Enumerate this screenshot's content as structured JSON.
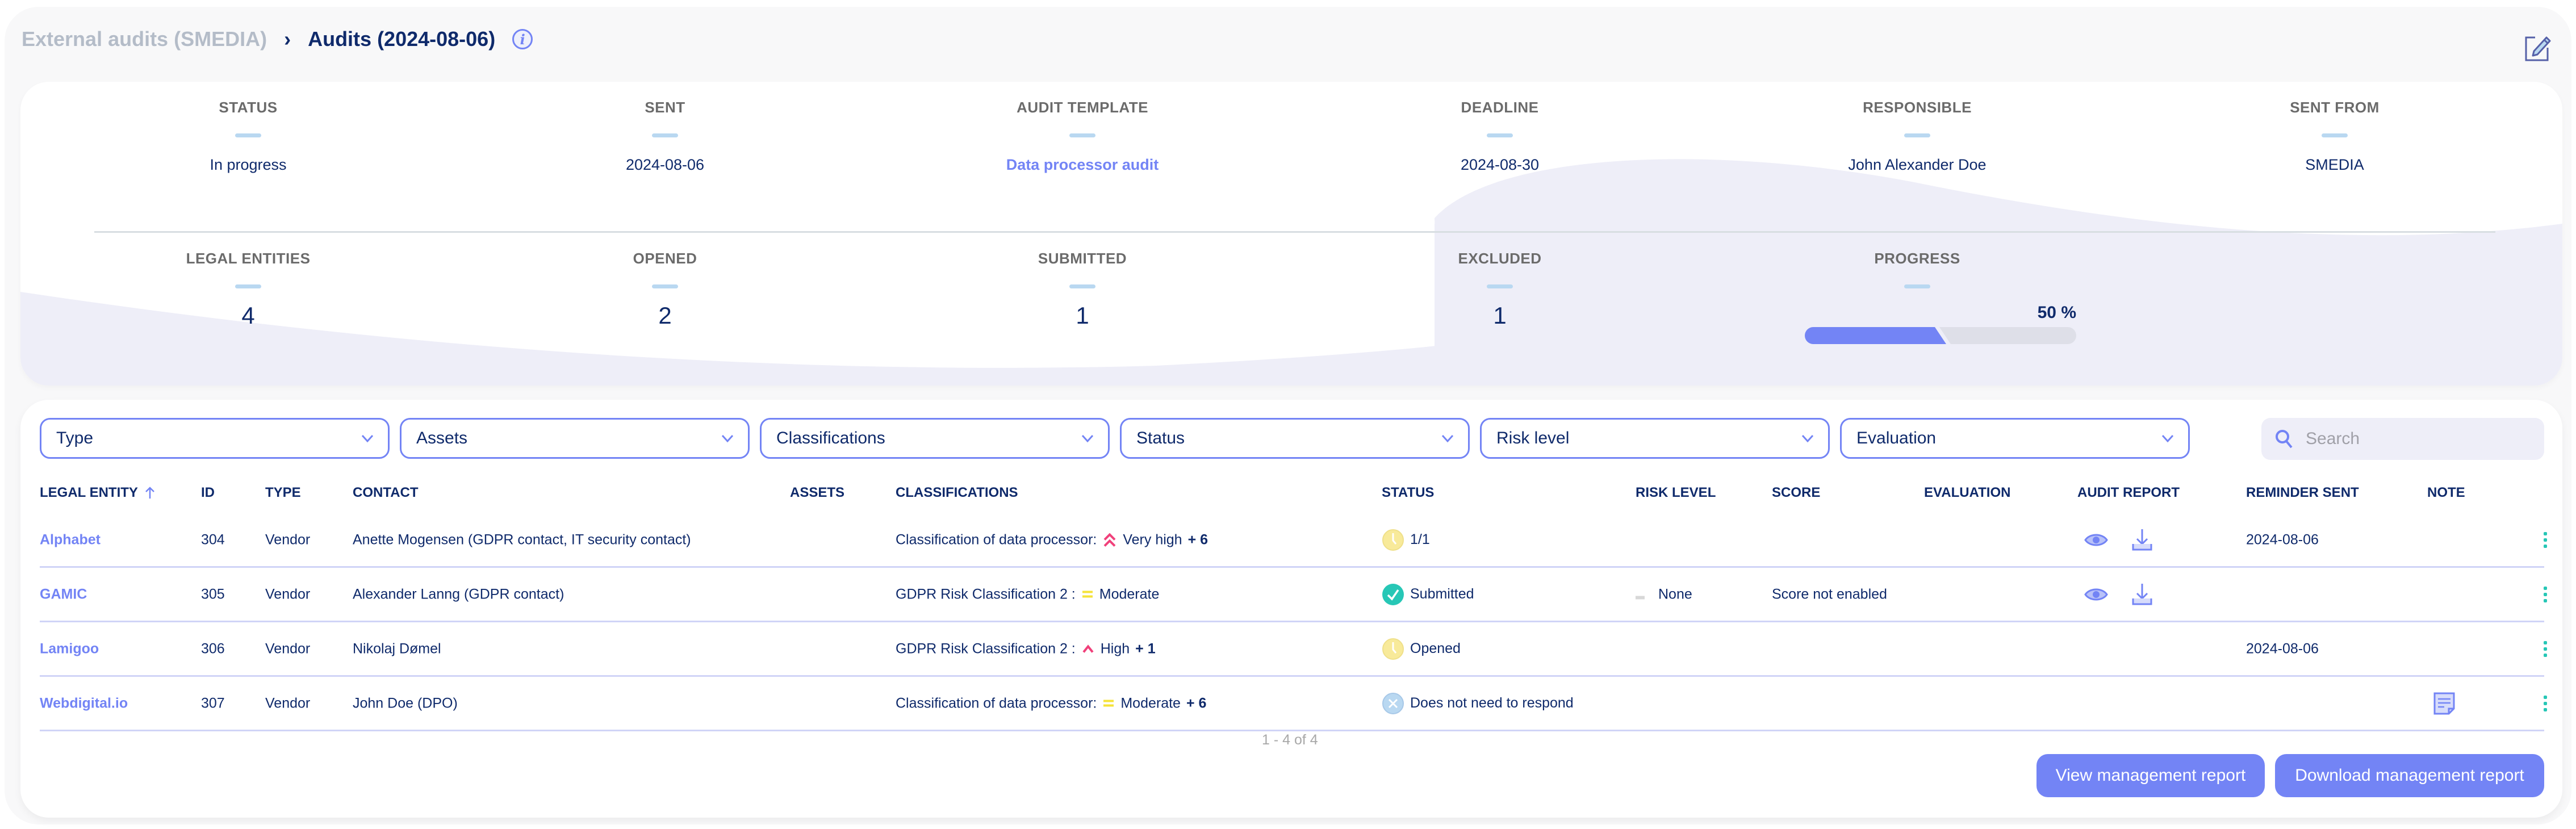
{
  "breadcrumb": {
    "parent": "External audits (SMEDIA)",
    "separator": "›",
    "current": "Audits (2024-08-06)",
    "info_icon": "info-icon"
  },
  "header_actions": {
    "edit_icon": "edit-pencil-icon"
  },
  "summary": {
    "top": [
      {
        "label": "STATUS",
        "value": "In progress"
      },
      {
        "label": "SENT",
        "value": "2024-08-06"
      },
      {
        "label": "AUDIT TEMPLATE",
        "value": "Data processor audit",
        "link": true
      },
      {
        "label": "DEADLINE",
        "value": "2024-08-30"
      },
      {
        "label": "RESPONSIBLE",
        "value": "John Alexander Doe"
      },
      {
        "label": "SENT FROM",
        "value": "SMEDIA"
      }
    ],
    "bottom": [
      {
        "label": "LEGAL ENTITIES",
        "value": "4"
      },
      {
        "label": "OPENED",
        "value": "2"
      },
      {
        "label": "SUBMITTED",
        "value": "1"
      },
      {
        "label": "EXCLUDED",
        "value": "1"
      }
    ],
    "progress": {
      "label": "PROGRESS",
      "value_text": "50 %",
      "fraction": 0.5
    }
  },
  "filters": [
    {
      "label": "Type"
    },
    {
      "label": "Assets"
    },
    {
      "label": "Classifications"
    },
    {
      "label": "Status"
    },
    {
      "label": "Risk level"
    },
    {
      "label": "Evaluation"
    }
  ],
  "search": {
    "placeholder": "Search",
    "value": ""
  },
  "table": {
    "columns": {
      "legal_entity": "LEGAL ENTITY",
      "id": "ID",
      "type": "TYPE",
      "contact": "CONTACT",
      "assets": "ASSETS",
      "classifications": "CLASSIFICATIONS",
      "status": "STATUS",
      "risk_level": "RISK LEVEL",
      "score": "SCORE",
      "evaluation": "EVALUATION",
      "audit_report": "AUDIT REPORT",
      "reminder_sent": "REMINDER SENT",
      "note": "NOTE"
    },
    "sort": {
      "column": "legal_entity",
      "direction": "ascending"
    },
    "rows": [
      {
        "legal_entity": "Alphabet",
        "id": "304",
        "type": "Vendor",
        "contact": "Anette Mogensen (GDPR contact, IT security contact)",
        "assets": "",
        "classification_name": "Classification of data processor:",
        "classification_level": "Very high",
        "classification_icon": "double-chevron-up-icon",
        "classification_color": "#f0407a",
        "classification_more": "+ 6",
        "status": "1/1",
        "status_icon": "clock-icon",
        "status_color": "#f8ea9a",
        "risk_level": "",
        "score": "",
        "evaluation": "",
        "audit_report": true,
        "reminder_sent": "2024-08-06",
        "note": false
      },
      {
        "legal_entity": "GAMIC",
        "id": "305",
        "type": "Vendor",
        "contact": "Alexander Lanng (GDPR contact)",
        "assets": "",
        "classification_name": "GDPR Risk Classification 2 :",
        "classification_level": "Moderate",
        "classification_icon": "equals-icon",
        "classification_color": "#f5e33a",
        "classification_more": "",
        "status": "Submitted",
        "status_icon": "check-circle-icon",
        "status_color": "#27c7b6",
        "risk_level": "None",
        "score": "Score not enabled",
        "evaluation": "",
        "audit_report": true,
        "reminder_sent": "",
        "note": false
      },
      {
        "legal_entity": "Lamigoo",
        "id": "306",
        "type": "Vendor",
        "contact": "Nikolaj Dømel",
        "assets": "",
        "classification_name": "GDPR Risk Classification 2 :",
        "classification_level": "High",
        "classification_icon": "chevron-up-icon",
        "classification_color": "#f0407a",
        "classification_more": "+ 1",
        "status": "Opened",
        "status_icon": "clock-icon",
        "status_color": "#f8ea9a",
        "risk_level": "",
        "score": "",
        "evaluation": "",
        "audit_report": false,
        "reminder_sent": "2024-08-06",
        "note": false
      },
      {
        "legal_entity": "Webdigital.io",
        "id": "307",
        "type": "Vendor",
        "contact": "John Doe (DPO)",
        "assets": "",
        "classification_name": "Classification of data processor:",
        "classification_level": "Moderate",
        "classification_icon": "equals-icon",
        "classification_color": "#f5e33a",
        "classification_more": "+ 6",
        "status": "Does not need to respond",
        "status_icon": "x-circle-icon",
        "status_color": "#b9d8f1",
        "risk_level": "",
        "score": "",
        "evaluation": "",
        "audit_report": false,
        "reminder_sent": "",
        "note": true
      }
    ]
  },
  "pagination": {
    "text": "1 - 4 of 4"
  },
  "actions": {
    "view_report": "View management report",
    "download_report": "Download management report"
  },
  "colors": {
    "accent": "#7384f5",
    "text": "#0f2a6b",
    "muted": "#b4bcc8",
    "teal": "#27c7b6",
    "progress_track": "#dedfe8"
  }
}
